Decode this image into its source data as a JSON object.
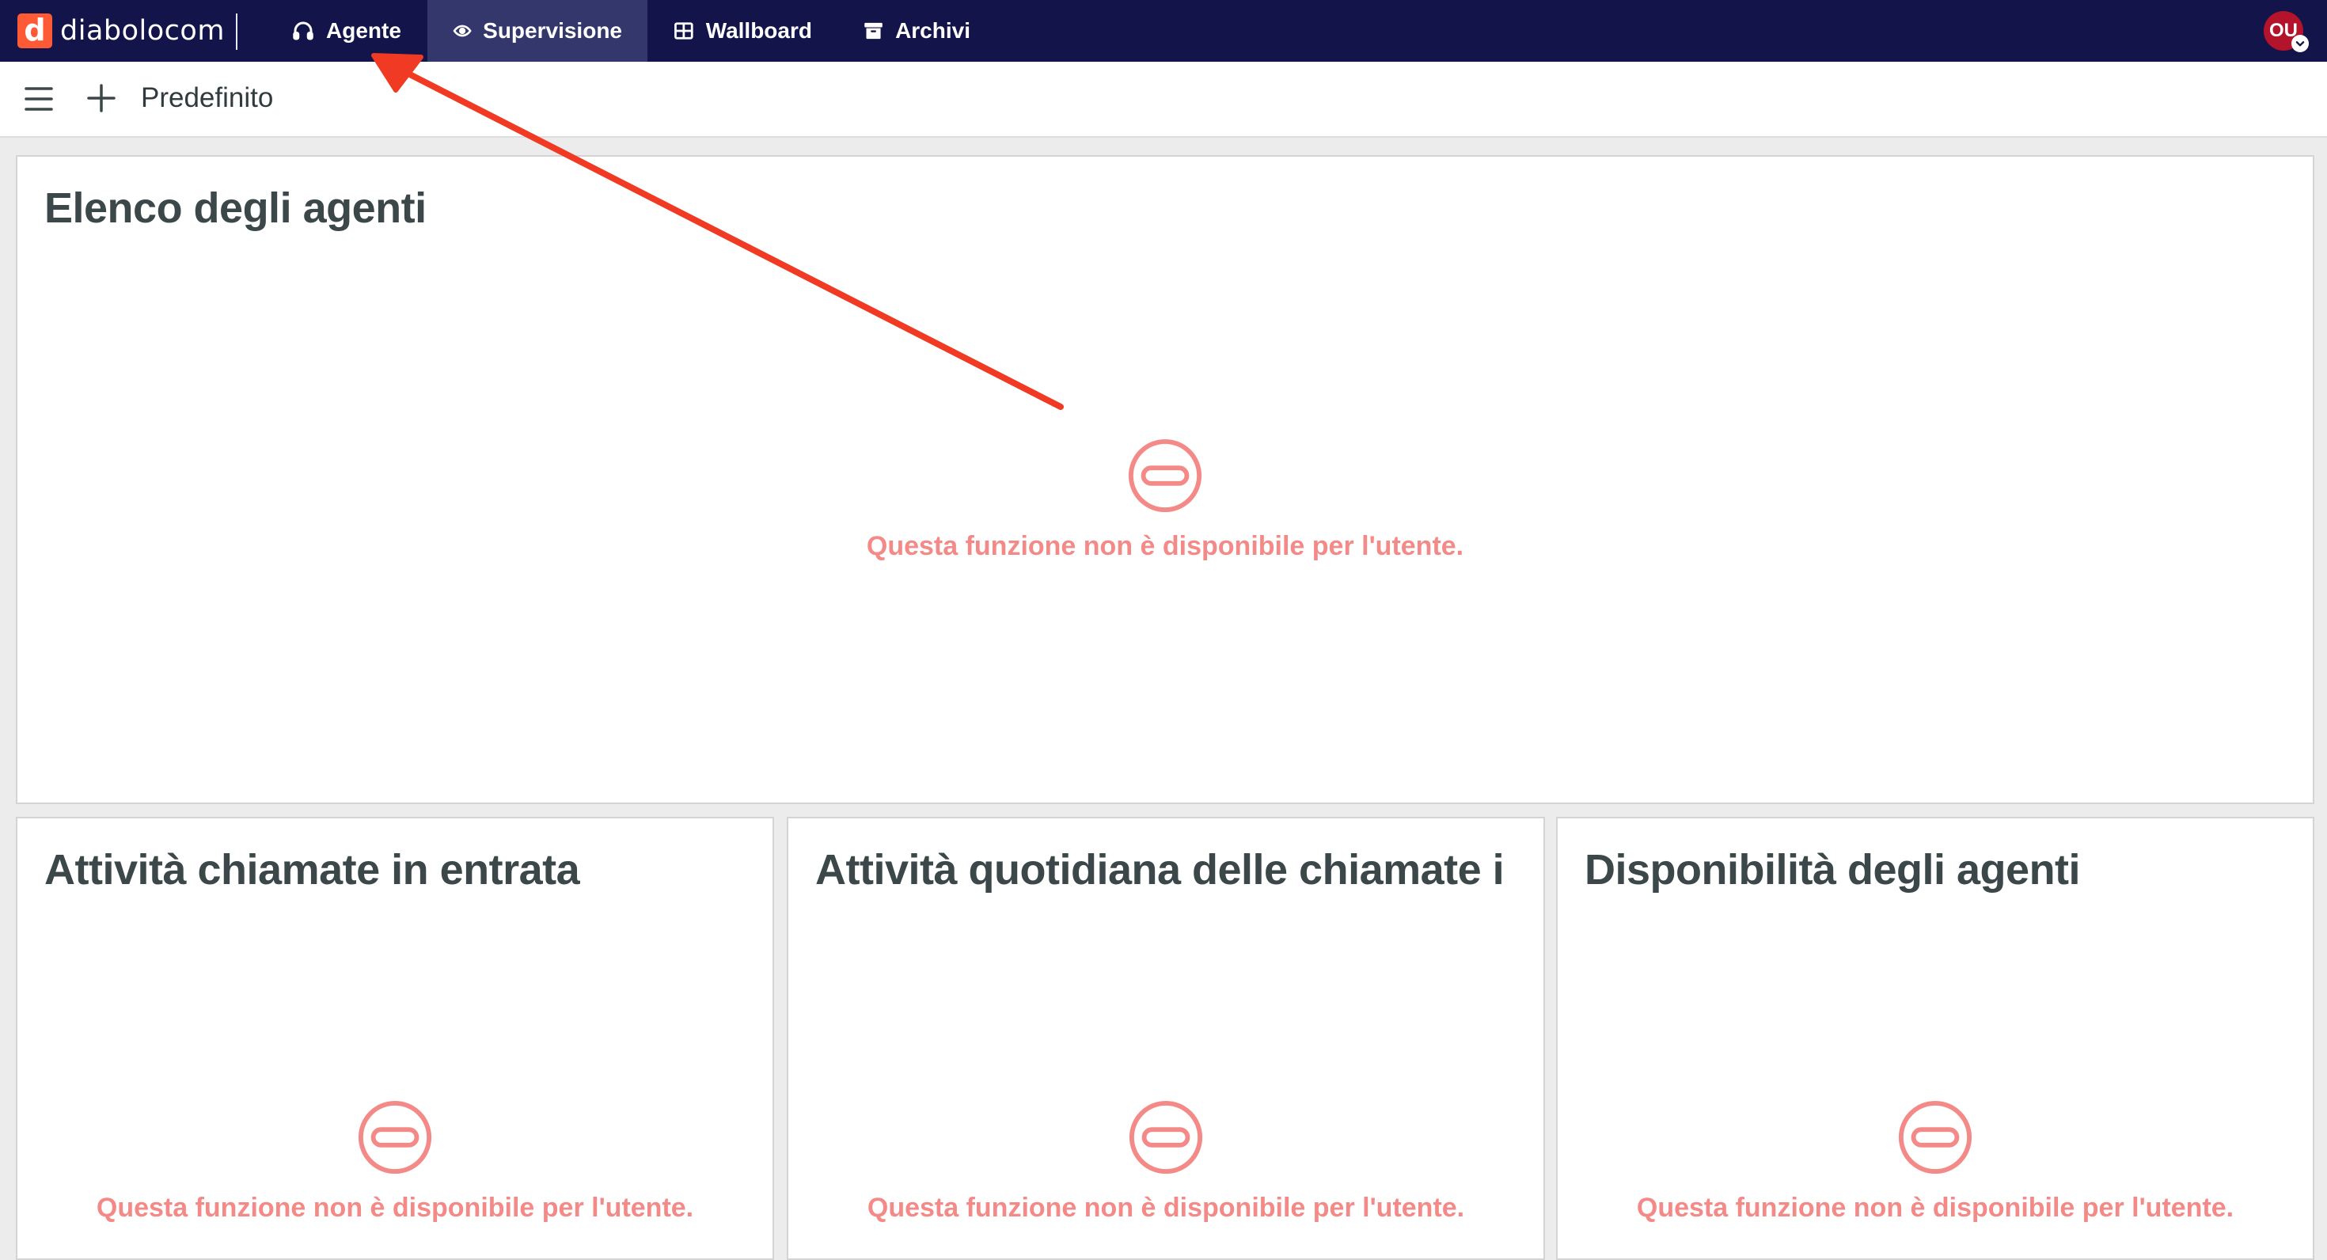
{
  "app": {
    "logo_letter": "d",
    "logo_text": "diabolocom",
    "brand_color": "#ff5a36",
    "header_color": "#13154a"
  },
  "nav": [
    {
      "label": "Agente",
      "icon": "headphones-icon",
      "active": false
    },
    {
      "label": "Supervisione",
      "icon": "eye-icon",
      "active": true
    },
    {
      "label": "Wallboard",
      "icon": "grid-icon",
      "active": false
    },
    {
      "label": "Archivi",
      "icon": "archive-icon",
      "active": false
    }
  ],
  "user": {
    "initials": "OU",
    "avatar_color": "#b3132b"
  },
  "toolbar": {
    "title": "Predefinito"
  },
  "panels": {
    "agents_list": {
      "title": "Elenco degli agenti",
      "message": "Questa funzione non è disponibile per l'utente."
    },
    "inbound_activity": {
      "title": "Attività chiamate in entrata",
      "message": "Questa funzione non è disponibile per l'utente."
    },
    "daily_activity": {
      "title": "Attività quotidiana delle chiamate i",
      "message": "Questa funzione non è disponibile per l'utente."
    },
    "agent_availability": {
      "title": "Disponibilità degli agenti",
      "message": "Questa funzione non è disponibile per l'utente."
    }
  },
  "annotation": {
    "arrow_color": "#f03a23",
    "unavailable_color": "#f48a88"
  }
}
